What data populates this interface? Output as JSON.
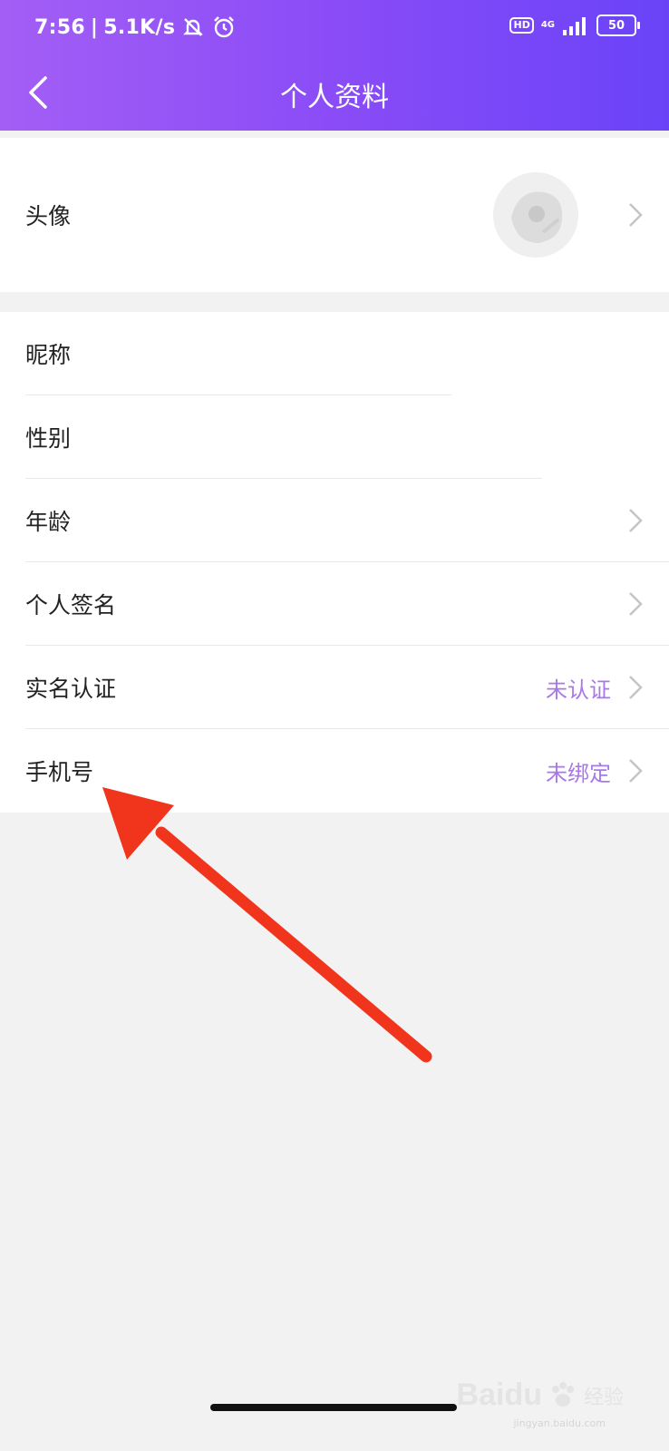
{
  "status_bar": {
    "time": "7:56",
    "net_speed": "5.1K/s",
    "hd_label": "HD",
    "network_type": "4G",
    "battery_level": "50"
  },
  "nav": {
    "title": "个人资料"
  },
  "profile": {
    "avatar_label": "头像",
    "rows": [
      {
        "label": "昵称",
        "value": ""
      },
      {
        "label": "性别",
        "value": ""
      },
      {
        "label": "年龄",
        "value": ""
      },
      {
        "label": "个人签名",
        "value": ""
      },
      {
        "label": "实名认证",
        "value": "未认证"
      },
      {
        "label": "手机号",
        "value": "未绑定"
      }
    ]
  },
  "watermark": {
    "brand": "Baidu",
    "sub": "经验",
    "url": "jingyan.baidu.com"
  },
  "colors": {
    "header_start": "#a35ef5",
    "header_end": "#6a43f8",
    "value_text": "#a878e8",
    "annotation_arrow": "#f0351c"
  }
}
